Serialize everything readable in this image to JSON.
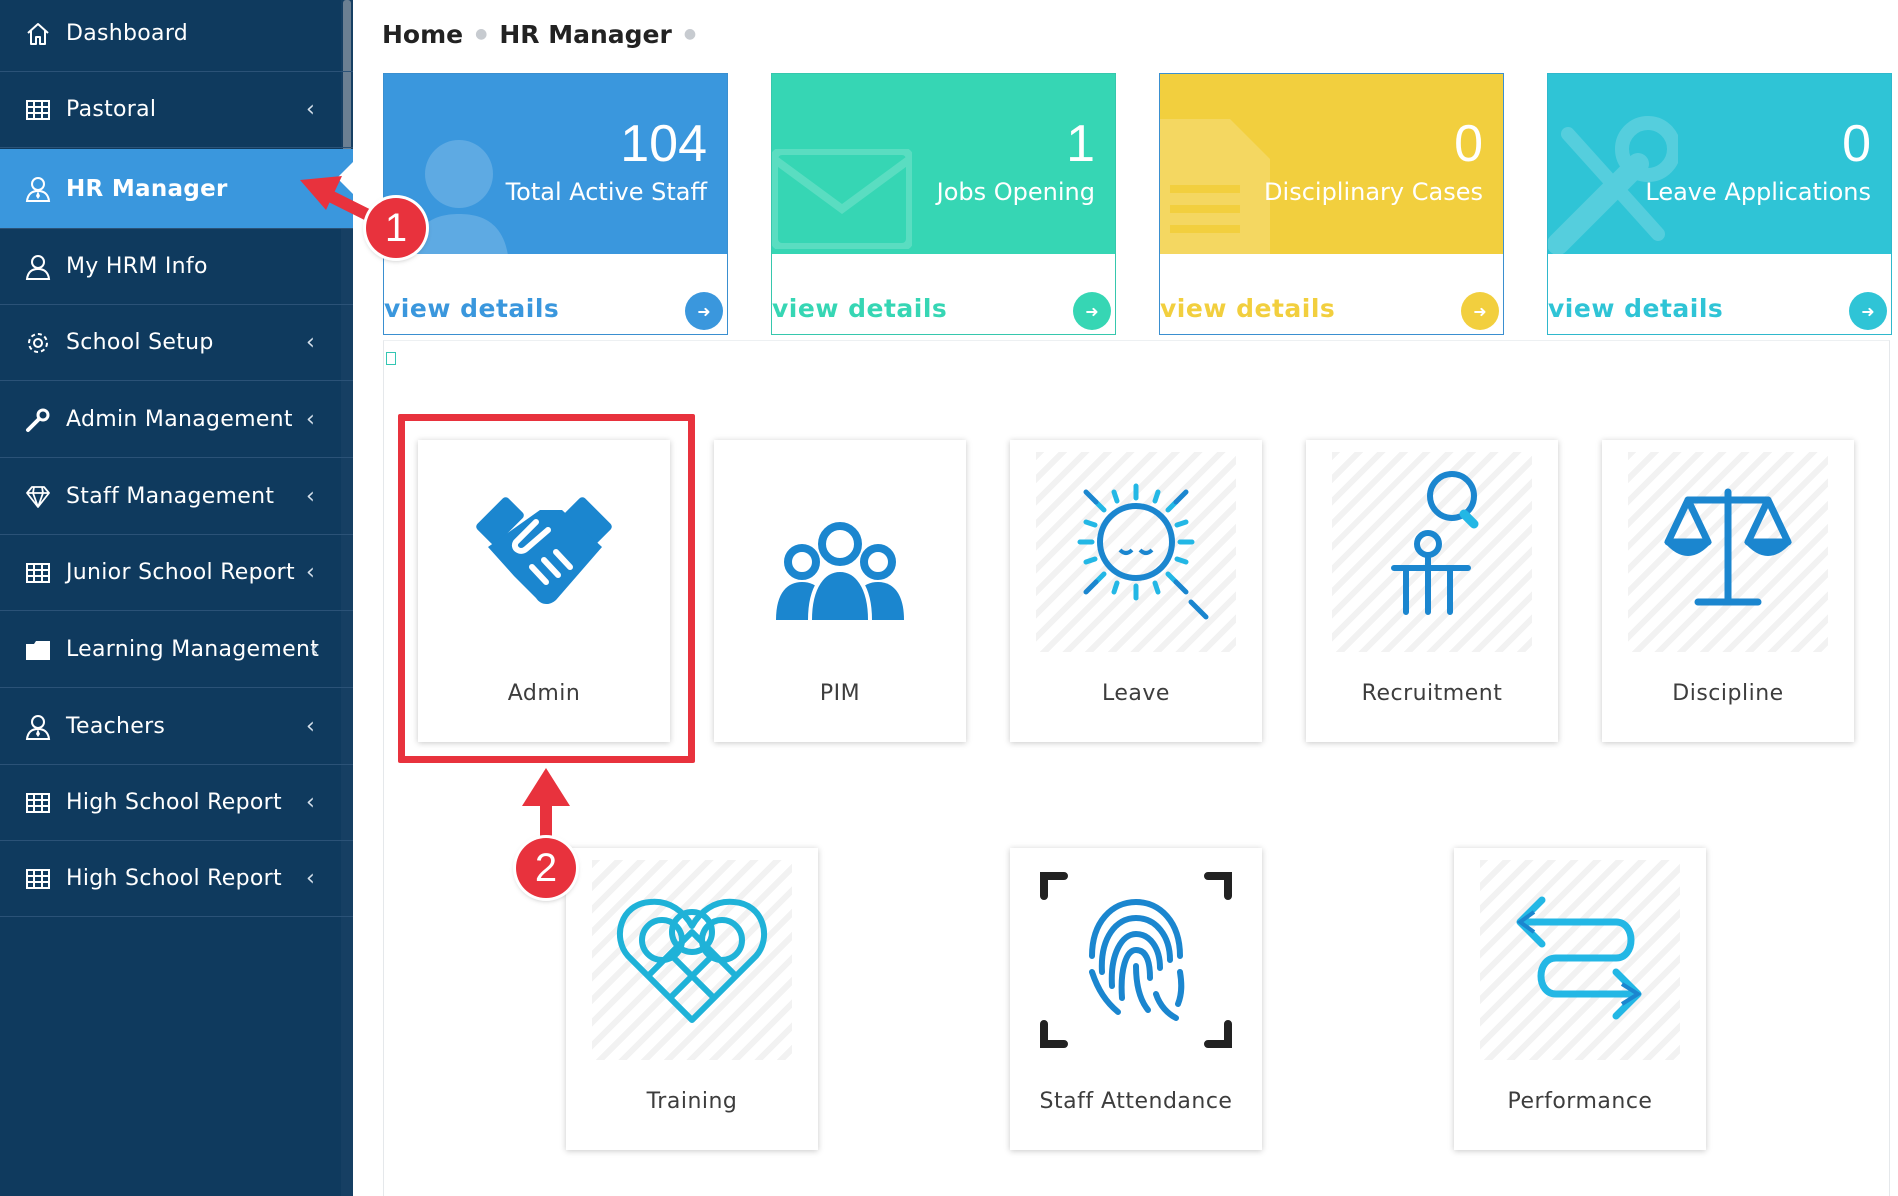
{
  "sidebar": {
    "items": [
      {
        "label": "Dashboard",
        "icon": "home-icon",
        "chevron": ""
      },
      {
        "label": "Pastoral",
        "icon": "table-icon",
        "chevron": "‹"
      },
      {
        "label": "HR Manager",
        "icon": "user-tie-icon",
        "chevron": "",
        "active": true
      },
      {
        "label": "My HRM Info",
        "icon": "user-icon",
        "chevron": ""
      },
      {
        "label": "School Setup",
        "icon": "gear-icon",
        "chevron": "‹"
      },
      {
        "label": "Admin Management",
        "icon": "wrench-icon",
        "chevron": "‹"
      },
      {
        "label": "Staff Management",
        "icon": "diamond-icon",
        "chevron": "‹"
      },
      {
        "label": "Junior School Report",
        "icon": "table-icon",
        "chevron": "‹"
      },
      {
        "label": "Learning Management",
        "icon": "folder-icon",
        "chevron": "‹"
      },
      {
        "label": "Teachers",
        "icon": "user-tie-icon",
        "chevron": "‹"
      },
      {
        "label": "High School Report",
        "icon": "table-icon",
        "chevron": "‹"
      },
      {
        "label": "High School Report",
        "icon": "table-icon",
        "chevron": "‹"
      }
    ]
  },
  "breadcrumb": {
    "home": "Home",
    "current": "HR Manager"
  },
  "stats": [
    {
      "value": "104",
      "caption": "Total Active Staff",
      "link": "view details",
      "color": "#3a97dd"
    },
    {
      "value": "1",
      "caption": "Jobs Opening",
      "link": "view details",
      "color": "#36d6b4"
    },
    {
      "value": "0",
      "caption": "Disciplinary Cases",
      "link": "view details",
      "color": "#f2cf3e"
    },
    {
      "value": "0",
      "caption": "Leave Applications",
      "link": "view details",
      "color": "#2fc4d6"
    }
  ],
  "modules": [
    {
      "label": "Admin",
      "icon": "handshake-icon"
    },
    {
      "label": "PIM",
      "icon": "people-group-icon"
    },
    {
      "label": "Leave",
      "icon": "sun-icon"
    },
    {
      "label": "Recruitment",
      "icon": "idea-desk-icon"
    },
    {
      "label": "Discipline",
      "icon": "scales-icon"
    },
    {
      "label": "Training",
      "icon": "heart-icon"
    },
    {
      "label": "Staff Attendance",
      "icon": "fingerprint-icon"
    },
    {
      "label": "Performance",
      "icon": "swap-arrows-icon"
    }
  ],
  "annotations": {
    "step1": "1",
    "step2": "2"
  },
  "colors": {
    "sidebar": "#0f3a5e",
    "active": "#3a97dd",
    "icon_blue": "#1b86cf",
    "annotation_red": "#e8323d"
  }
}
